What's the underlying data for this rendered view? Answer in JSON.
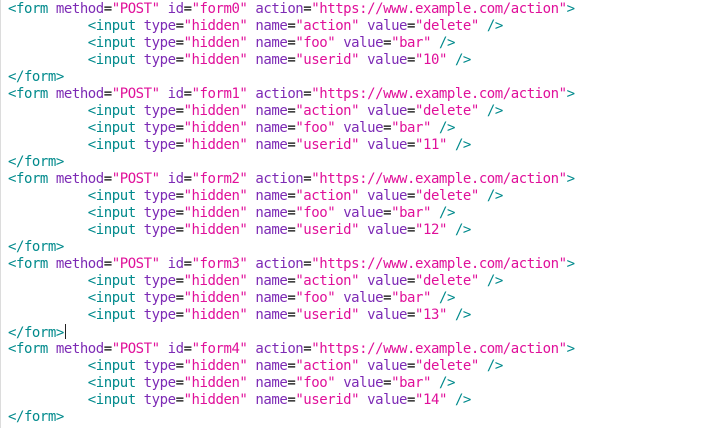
{
  "editor": {
    "indent": "          ",
    "forms": [
      {
        "open": {
          "lt": "<",
          "tag": "form",
          "method_attr": "method",
          "method_val": "\"POST\"",
          "id_attr": "id",
          "id_val": "\"form0\"",
          "action_attr": "action",
          "action_val": "\"https://www.example.com/action\"",
          "gt": ">"
        },
        "inputs": [
          {
            "lt": "<",
            "tag": "input",
            "type_attr": "type",
            "type_val": "\"hidden\"",
            "name_attr": "name",
            "name_val": "\"action\"",
            "value_attr": "value",
            "value_val": "\"delete\"",
            "end": "/>"
          },
          {
            "lt": "<",
            "tag": "input",
            "type_attr": "type",
            "type_val": "\"hidden\"",
            "name_attr": "name",
            "name_val": "\"foo\"",
            "value_attr": "value",
            "value_val": "\"bar\"",
            "end": "/>"
          },
          {
            "lt": "<",
            "tag": "input",
            "type_attr": "type",
            "type_val": "\"hidden\"",
            "name_attr": "name",
            "name_val": "\"userid\"",
            "value_attr": "value",
            "value_val": "\"10\"",
            "end": "/>"
          }
        ],
        "close": "</form>"
      },
      {
        "open": {
          "lt": "<",
          "tag": "form",
          "method_attr": "method",
          "method_val": "\"POST\"",
          "id_attr": "id",
          "id_val": "\"form1\"",
          "action_attr": "action",
          "action_val": "\"https://www.example.com/action\"",
          "gt": ">"
        },
        "inputs": [
          {
            "lt": "<",
            "tag": "input",
            "type_attr": "type",
            "type_val": "\"hidden\"",
            "name_attr": "name",
            "name_val": "\"action\"",
            "value_attr": "value",
            "value_val": "\"delete\"",
            "end": "/>"
          },
          {
            "lt": "<",
            "tag": "input",
            "type_attr": "type",
            "type_val": "\"hidden\"",
            "name_attr": "name",
            "name_val": "\"foo\"",
            "value_attr": "value",
            "value_val": "\"bar\"",
            "end": "/>"
          },
          {
            "lt": "<",
            "tag": "input",
            "type_attr": "type",
            "type_val": "\"hidden\"",
            "name_attr": "name",
            "name_val": "\"userid\"",
            "value_attr": "value",
            "value_val": "\"11\"",
            "end": "/>"
          }
        ],
        "close": "</form>"
      },
      {
        "open": {
          "lt": "<",
          "tag": "form",
          "method_attr": "method",
          "method_val": "\"POST\"",
          "id_attr": "id",
          "id_val": "\"form2\"",
          "action_attr": "action",
          "action_val": "\"https://www.example.com/action\"",
          "gt": ">"
        },
        "inputs": [
          {
            "lt": "<",
            "tag": "input",
            "type_attr": "type",
            "type_val": "\"hidden\"",
            "name_attr": "name",
            "name_val": "\"action\"",
            "value_attr": "value",
            "value_val": "\"delete\"",
            "end": "/>"
          },
          {
            "lt": "<",
            "tag": "input",
            "type_attr": "type",
            "type_val": "\"hidden\"",
            "name_attr": "name",
            "name_val": "\"foo\"",
            "value_attr": "value",
            "value_val": "\"bar\"",
            "end": "/>"
          },
          {
            "lt": "<",
            "tag": "input",
            "type_attr": "type",
            "type_val": "\"hidden\"",
            "name_attr": "name",
            "name_val": "\"userid\"",
            "value_attr": "value",
            "value_val": "\"12\"",
            "end": "/>"
          }
        ],
        "close": "</form>"
      },
      {
        "open": {
          "lt": "<",
          "tag": "form",
          "method_attr": "method",
          "method_val": "\"POST\"",
          "id_attr": "id",
          "id_val": "\"form3\"",
          "action_attr": "action",
          "action_val": "\"https://www.example.com/action\"",
          "gt": ">"
        },
        "inputs": [
          {
            "lt": "<",
            "tag": "input",
            "type_attr": "type",
            "type_val": "\"hidden\"",
            "name_attr": "name",
            "name_val": "\"action\"",
            "value_attr": "value",
            "value_val": "\"delete\"",
            "end": "/>"
          },
          {
            "lt": "<",
            "tag": "input",
            "type_attr": "type",
            "type_val": "\"hidden\"",
            "name_attr": "name",
            "name_val": "\"foo\"",
            "value_attr": "value",
            "value_val": "\"bar\"",
            "end": "/>"
          },
          {
            "lt": "<",
            "tag": "input",
            "type_attr": "type",
            "type_val": "\"hidden\"",
            "name_attr": "name",
            "name_val": "\"userid\"",
            "value_attr": "value",
            "value_val": "\"13\"",
            "end": "/>"
          }
        ],
        "close": "</form>",
        "cursor_after_close": true
      },
      {
        "open": {
          "lt": "<",
          "tag": "form",
          "method_attr": "method",
          "method_val": "\"POST\"",
          "id_attr": "id",
          "id_val": "\"form4\"",
          "action_attr": "action",
          "action_val": "\"https://www.example.com/action\"",
          "gt": ">"
        },
        "inputs": [
          {
            "lt": "<",
            "tag": "input",
            "type_attr": "type",
            "type_val": "\"hidden\"",
            "name_attr": "name",
            "name_val": "\"action\"",
            "value_attr": "value",
            "value_val": "\"delete\"",
            "end": "/>"
          },
          {
            "lt": "<",
            "tag": "input",
            "type_attr": "type",
            "type_val": "\"hidden\"",
            "name_attr": "name",
            "name_val": "\"foo\"",
            "value_attr": "value",
            "value_val": "\"bar\"",
            "end": "/>"
          },
          {
            "lt": "<",
            "tag": "input",
            "type_attr": "type",
            "type_val": "\"hidden\"",
            "name_attr": "name",
            "name_val": "\"userid\"",
            "value_attr": "value",
            "value_val": "\"14\"",
            "end": "/>"
          }
        ],
        "close": "</form>"
      }
    ],
    "colors": {
      "tag": "#008a8c",
      "attribute": "#7d2ab5",
      "string": "#e0109a",
      "background": "#ffffff"
    }
  }
}
